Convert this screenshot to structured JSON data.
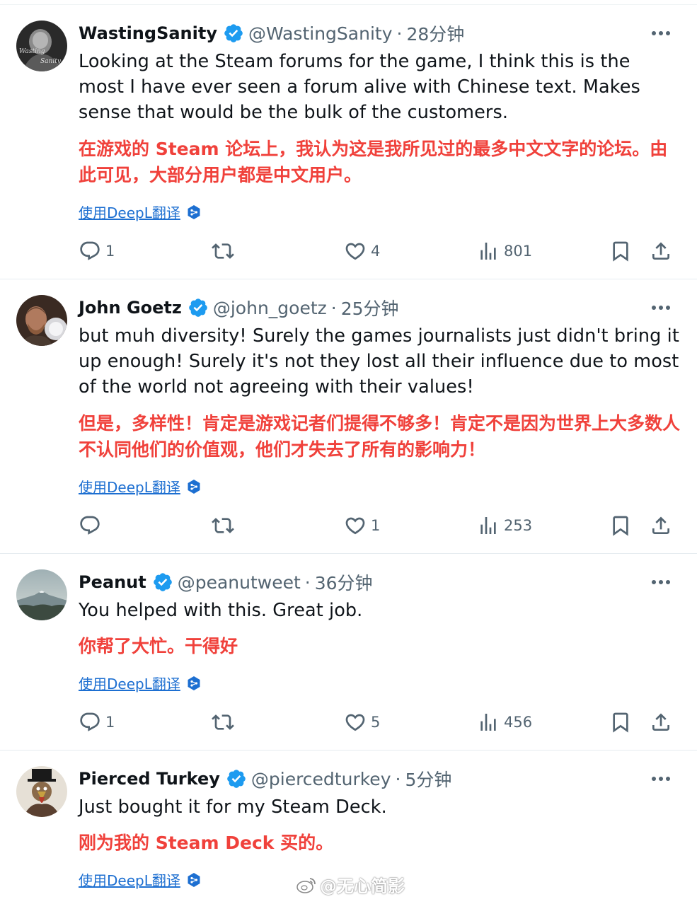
{
  "tweets": [
    {
      "name": "WastingSanity",
      "handle": "@WastingSanity",
      "time": "28分钟",
      "text_en": "Looking at the Steam forums for the game, I think this is the most I have ever seen a forum alive with Chinese text. Makes sense that would be the bulk of the customers.",
      "text_zh": "在游戏的 Steam 论坛上，我认为这是我所见过的最多中文文字的论坛。由此可见，大部分用户都是中文用户。",
      "translate_label": "使用DeepL翻译",
      "replies": "1",
      "reposts": "",
      "likes": "4",
      "views": "801"
    },
    {
      "name": "John Goetz",
      "handle": "@john_goetz",
      "time": "25分钟",
      "text_en": "but muh diversity!  Surely the games journalists just didn't bring it up enough!  Surely it's not they lost all their influence due to most of the world not agreeing with their values!",
      "text_zh": "但是，多样性！肯定是游戏记者们提得不够多！肯定不是因为世界上大多数人不认同他们的价值观，他们才失去了所有的影响力！",
      "translate_label": "使用DeepL翻译",
      "replies": "",
      "reposts": "",
      "likes": "1",
      "views": "253"
    },
    {
      "name": "Peanut",
      "handle": "@peanutweet",
      "time": "36分钟",
      "text_en": "You helped with this.  Great job.",
      "text_zh": "你帮了大忙。干得好",
      "translate_label": "使用DeepL翻译",
      "replies": "1",
      "reposts": "",
      "likes": "5",
      "views": "456"
    },
    {
      "name": "Pierced Turkey",
      "handle": "@piercedturkey",
      "time": "5分钟",
      "text_en": "Just bought it for my Steam Deck.",
      "text_zh": "刚为我的 Steam Deck 买的。",
      "translate_label": "使用DeepL翻译"
    }
  ],
  "watermark": "@无心简影",
  "colors": {
    "verified": "#1d9bf0",
    "translation": "#f0413b",
    "link": "#1d6fd1",
    "muted": "#536471"
  },
  "icons": [
    "reply-icon",
    "repost-icon",
    "like-icon",
    "views-icon",
    "bookmark-icon",
    "share-icon",
    "more-icon",
    "verified-badge-icon",
    "deepl-icon",
    "weibo-icon"
  ]
}
